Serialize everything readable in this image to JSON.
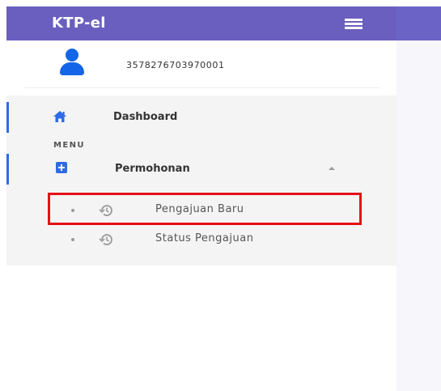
{
  "app": {
    "title": "KTP-el"
  },
  "user": {
    "id": "3578276703970001"
  },
  "nav": {
    "dashboard_label": "Dashboard",
    "menu_heading": "MENU",
    "permohonan_label": "Permohonan",
    "sub_items": [
      {
        "label": "Pengajuan Baru",
        "icon": "history-icon"
      },
      {
        "label": "Status Pengajuan",
        "icon": "history-icon"
      }
    ]
  },
  "colors": {
    "brand": "#6a5fbf",
    "accent": "#2f6be6",
    "highlight": "#e50f15"
  }
}
